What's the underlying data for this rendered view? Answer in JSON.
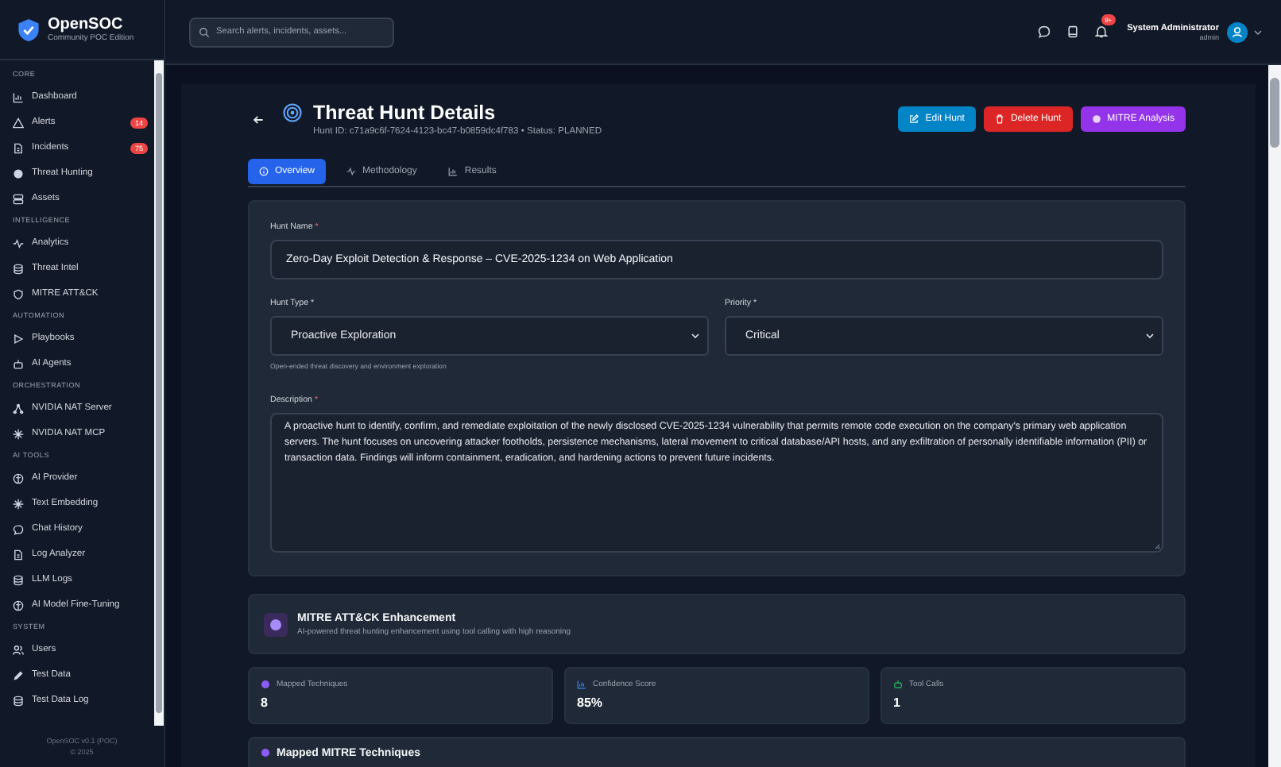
{
  "sidebar": {
    "brand": "OpenSOC",
    "edition": "Community POC Edition",
    "sections": [
      {
        "heading": "CORE",
        "items": [
          {
            "label": "Dashboard"
          },
          {
            "label": "Alerts",
            "badge": "14"
          },
          {
            "label": "Incidents",
            "badge": "75"
          },
          {
            "label": "Threat Hunting"
          },
          {
            "label": "Assets"
          }
        ]
      },
      {
        "heading": "INTELLIGENCE",
        "items": [
          {
            "label": "Analytics"
          },
          {
            "label": "Threat Intel"
          },
          {
            "label": "MITRE ATT&CK"
          }
        ]
      },
      {
        "heading": "AUTOMATION",
        "items": [
          {
            "label": "Playbooks"
          },
          {
            "label": "AI Agents"
          }
        ]
      },
      {
        "heading": "ORCHESTRATION",
        "items": [
          {
            "label": "NVIDIA NAT Server"
          },
          {
            "label": "NVIDIA NAT MCP"
          }
        ]
      },
      {
        "heading": "AI TOOLS",
        "items": [
          {
            "label": "AI Provider"
          },
          {
            "label": "Text Embedding"
          },
          {
            "label": "Chat History"
          },
          {
            "label": "Log Analyzer"
          },
          {
            "label": "LLM Logs"
          },
          {
            "label": "AI Model Fine-Tuning"
          }
        ]
      },
      {
        "heading": "SYSTEM",
        "items": [
          {
            "label": "Users"
          },
          {
            "label": "Test Data"
          },
          {
            "label": "Test Data Log"
          }
        ]
      }
    ],
    "footer": [
      "OpenSOC v0.1 (POC)",
      "© 2025"
    ]
  },
  "topbar": {
    "search": {
      "placeholder": "Search alerts, incidents, assets..."
    },
    "notification_badge": "9+",
    "user": {
      "name": "System Administrator",
      "role": "admin"
    }
  },
  "page": {
    "title": "Threat Hunt Details",
    "subtitle": "Hunt ID: c71a9c6f-7624-4123-bc47-b0859dc4f783 • Status: PLANNED",
    "buttons": [
      {
        "label": "Edit Hunt",
        "kind": "edit"
      },
      {
        "label": "Delete Hunt",
        "kind": "delete"
      },
      {
        "label": "MITRE Analysis",
        "kind": "mitre"
      }
    ],
    "tabs": [
      {
        "label": "Overview",
        "selected": true
      },
      {
        "label": "Methodology",
        "selected": false
      },
      {
        "label": "Results",
        "selected": false
      }
    ]
  },
  "form": {
    "hunt_name": {
      "label": "Hunt Name",
      "required_mark": "*",
      "value": "Zero-Day Exploit Detection & Response – CVE-2025-1234 on Web Application"
    },
    "hunt_type": {
      "label": "Hunt Type *",
      "value": "Proactive Exploration",
      "hint": "Open-ended threat discovery and environment exploration"
    },
    "priority": {
      "label": "Priority *",
      "value": "Critical"
    },
    "description": {
      "label": "Description",
      "required_mark": "*",
      "value": "A proactive hunt to identify, confirm, and remediate exploitation of the newly disclosed CVE-2025-1234 vulnerability that permits remote code execution on the company's primary web application servers. The hunt focuses on uncovering attacker footholds, persistence mechanisms, lateral movement to critical database/API hosts, and any exfiltration of personally identifiable information (PII) or transaction data. Findings will inform containment, eradication, and hardening actions to prevent future incidents."
    }
  },
  "enhancement": {
    "title": "MITRE ATT&CK Enhancement",
    "subtitle": "AI-powered threat hunting enhancement using tool calling with high reasoning"
  },
  "stats": [
    {
      "label": "Mapped Techniques",
      "value": "8",
      "kind": "techniques"
    },
    {
      "label": "Confidence Score",
      "value": "85%",
      "kind": "confidence"
    },
    {
      "label": "Tool Calls",
      "value": "1",
      "kind": "tools"
    }
  ],
  "techniques": {
    "title": "Mapped MITRE Techniques"
  }
}
